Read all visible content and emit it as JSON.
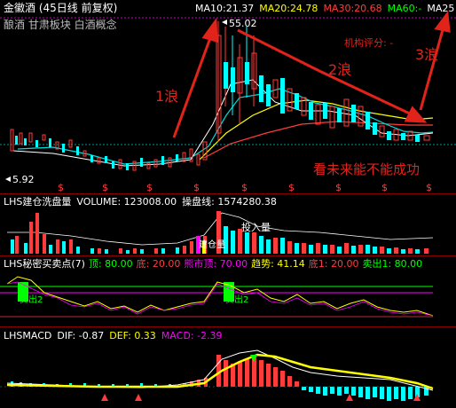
{
  "title": "金徽酒 (45日线 前复权)",
  "tags": "酿酒 甘肃板块 白酒概念",
  "ma": [
    {
      "label": "MA10:",
      "value": "21.37",
      "color": "#ffffff"
    },
    {
      "label": "MA20:",
      "value": "24.78",
      "color": "#ffff00"
    },
    {
      "label": "MA30:",
      "value": "20.68",
      "color": "#ff3c3c"
    },
    {
      "label": "MA60:",
      "value": "-",
      "color": "#00ff00"
    },
    {
      "label": "MA25",
      "value": "",
      "color": "#ffffff"
    }
  ],
  "price": {
    "high": "55.02",
    "low": "5.92"
  },
  "annotations": {
    "wave1": "1浪",
    "wave2": "2浪",
    "wave3": "3浪",
    "rating_label": "机构评分:",
    "rating_value": "-",
    "comment": "看未来能不能成功",
    "vol_note": "投入量",
    "vol_tag": "建仓量"
  },
  "indicator1": {
    "name": "LHS建仓洗盘量",
    "items": [
      {
        "text": "VOLUME: 123008.00",
        "color": "#ffffff"
      },
      {
        "text": "操盘线: 1574280.38",
        "color": "#ffffff"
      }
    ]
  },
  "indicator2": {
    "name": "LHS秘密买卖点(7)",
    "items": [
      {
        "text": "顶: 80.00",
        "color": "#00ff00"
      },
      {
        "text": "底: 20.00",
        "color": "#ff3c3c"
      },
      {
        "text": "熊市顶: 70.00",
        "color": "#ff00ff"
      },
      {
        "text": "趋势: 41.14",
        "color": "#ffff00"
      },
      {
        "text": "底1: 20.00",
        "color": "#ff3c3c"
      },
      {
        "text": "卖出1: 80.00",
        "color": "#00ff00"
      }
    ],
    "sell_marks": [
      "卖出2",
      "卖出2"
    ]
  },
  "indicator3": {
    "name": "LHSMACD",
    "items": [
      {
        "text": "DIF: -0.87",
        "color": "#ffffff"
      },
      {
        "text": "DEF: 0.33",
        "color": "#ffff00"
      },
      {
        "text": "MACD: -2.39",
        "color": "#ff00ff"
      }
    ]
  }
}
